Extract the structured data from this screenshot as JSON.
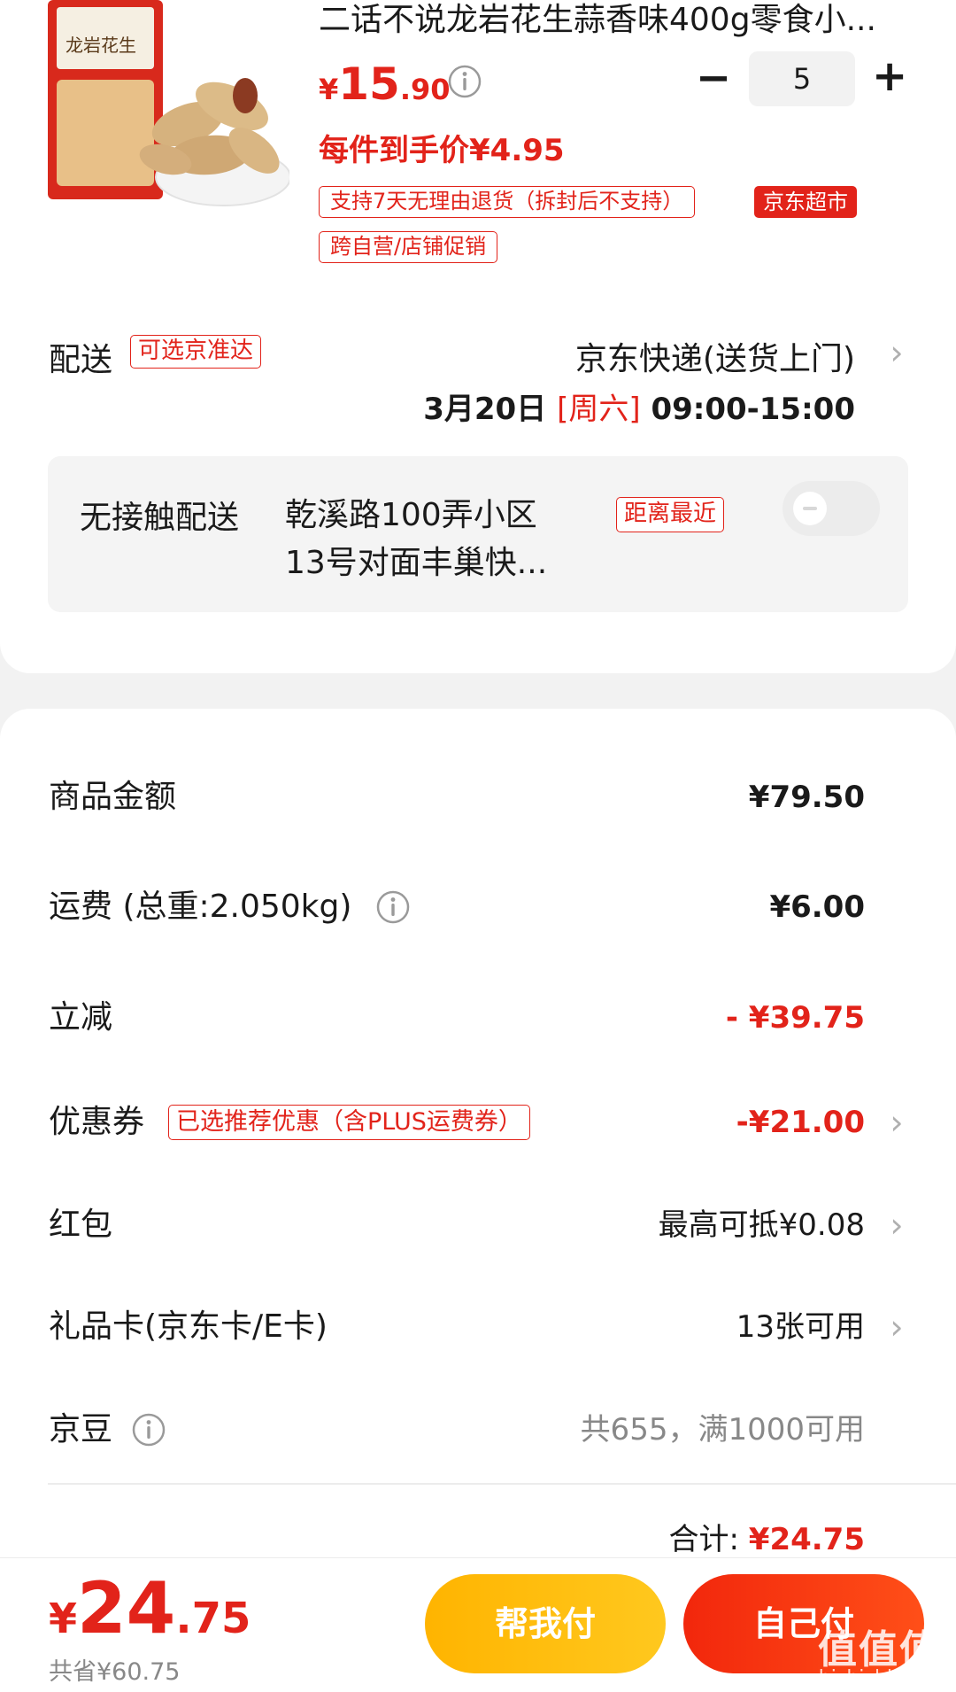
{
  "product": {
    "title": "二话不说龙岩花生蒜香味400g零食小...",
    "price_currency": "¥",
    "price_int": "15",
    "price_dec": ".90",
    "unit_price": "每件到手价¥4.95",
    "quantity": "5",
    "qty_minus": "−",
    "qty_plus": "+",
    "tags": [
      "支持7天无理由退货（拆封后不支持）",
      "跨自营/店铺促销"
    ],
    "badge": "京东超市",
    "package_text": "龙岩花生"
  },
  "delivery": {
    "label": "配送",
    "tag": "可选京准达",
    "method": "京东快递(送货上门)",
    "date": "3月20日",
    "weekday": "[周六]",
    "time": "09:00-15:00"
  },
  "contactless": {
    "label": "无接触配送",
    "address": "乾溪路100弄小区13号对面丰巢快...",
    "tag": "距离最近",
    "enabled": false
  },
  "summary": {
    "goods_label": "商品金额",
    "goods_value": "¥79.50",
    "shipping_label": "运费 (总重:2.050kg)",
    "shipping_value": "¥6.00",
    "discount_label": "立减",
    "discount_value": "- ¥39.75",
    "coupon_label": "优惠券",
    "coupon_tag": "已选推荐优惠（含PLUS运费券）",
    "coupon_value": "-¥21.00",
    "redpacket_label": "红包",
    "redpacket_value": "最高可抵¥0.08",
    "giftcard_label": "礼品卡(京东卡/E卡)",
    "giftcard_value": "13张可用",
    "beans_label": "京豆",
    "beans_value": "共655，满1000可用",
    "total_label": "合计:",
    "total_value": "¥24.75"
  },
  "bottom": {
    "currency": "¥",
    "total_int": "24",
    "total_dec": ".75",
    "savings": "共省¥60.75",
    "btn_help": "帮我付",
    "btn_self": "自己付"
  },
  "watermark": {
    "text": "值值值",
    "url": "zhizhizhi.com"
  },
  "colors": {
    "accent": "#e2231a",
    "help_btn": "#ffb400",
    "self_btn": "#f2270c"
  }
}
